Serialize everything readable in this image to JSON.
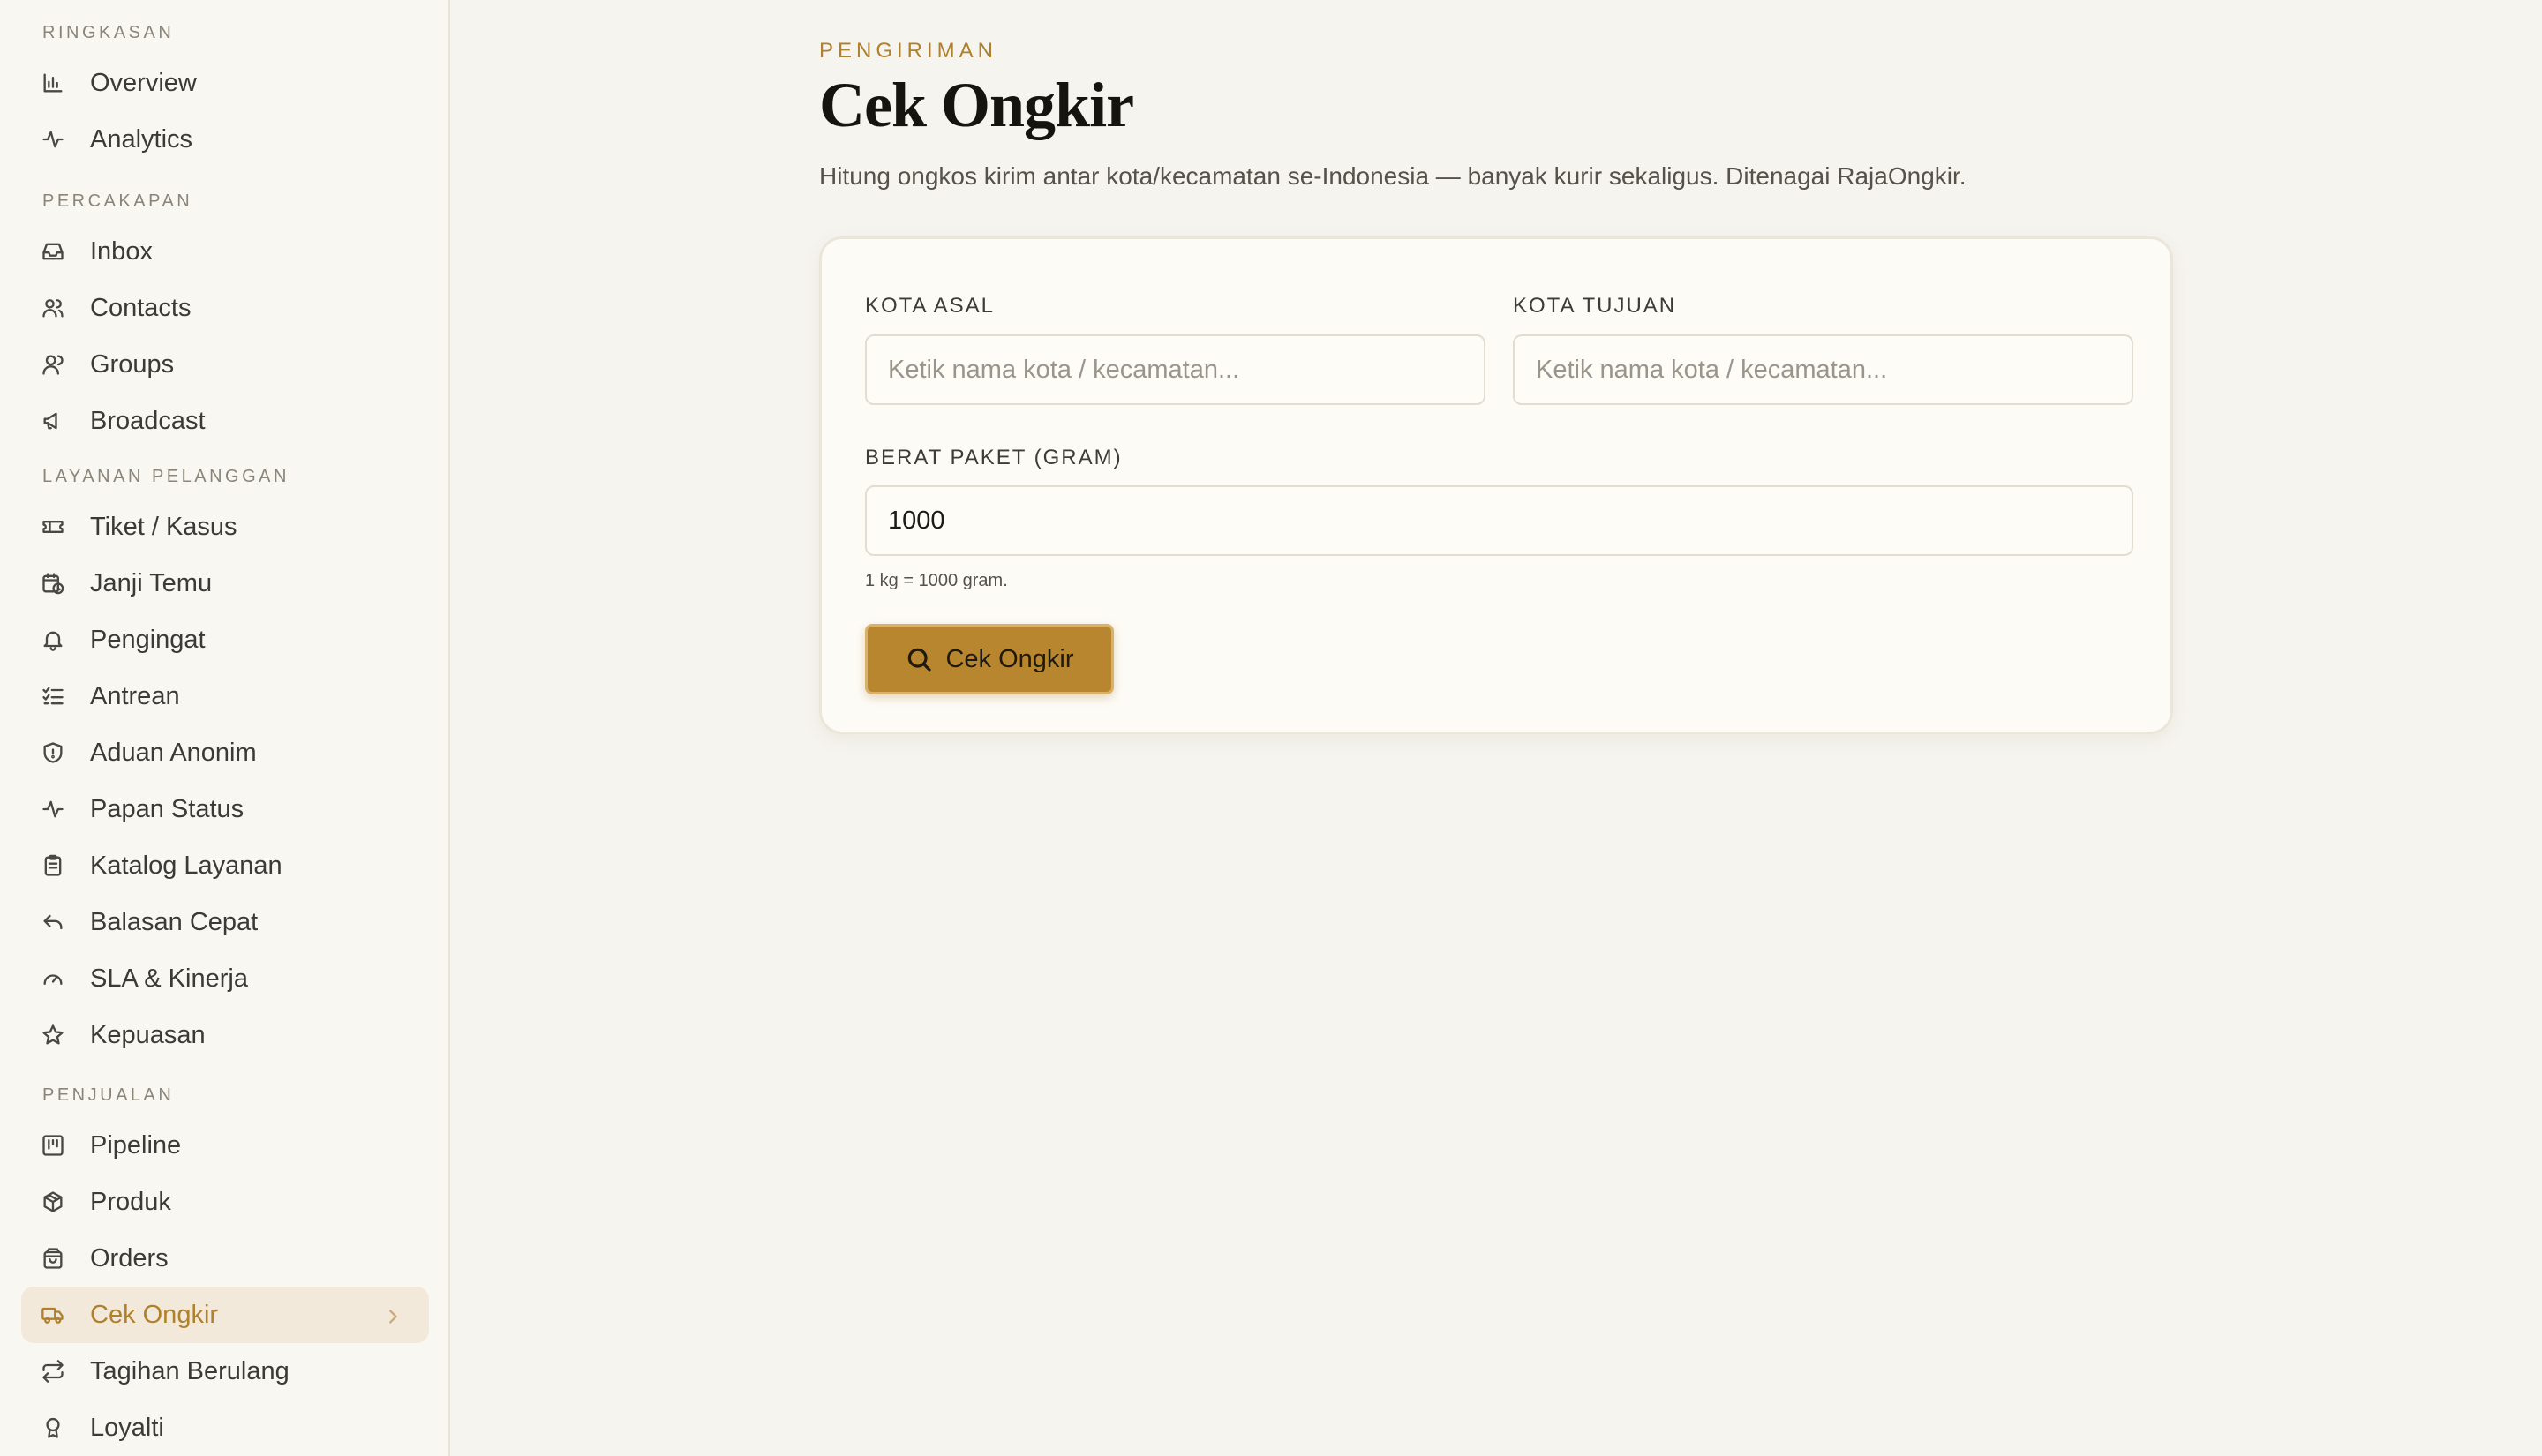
{
  "sidebar": {
    "sections": [
      {
        "title": "RINGKASAN",
        "items": [
          {
            "label": "Overview",
            "icon": "bar-chart-icon"
          },
          {
            "label": "Analytics",
            "icon": "activity-icon"
          }
        ]
      },
      {
        "title": "PERCAKAPAN",
        "items": [
          {
            "label": "Inbox",
            "icon": "inbox-icon"
          },
          {
            "label": "Contacts",
            "icon": "users-icon"
          },
          {
            "label": "Groups",
            "icon": "group-icon"
          },
          {
            "label": "Broadcast",
            "icon": "megaphone-icon"
          }
        ]
      },
      {
        "title": "LAYANAN PELANGGAN",
        "items": [
          {
            "label": "Tiket / Kasus",
            "icon": "ticket-icon"
          },
          {
            "label": "Janji Temu",
            "icon": "calendar-clock-icon"
          },
          {
            "label": "Pengingat",
            "icon": "bell-icon"
          },
          {
            "label": "Antrean",
            "icon": "list-checks-icon"
          },
          {
            "label": "Aduan Anonim",
            "icon": "shield-icon"
          },
          {
            "label": "Papan Status",
            "icon": "pulse-icon"
          },
          {
            "label": "Katalog Layanan",
            "icon": "clipboard-icon"
          },
          {
            "label": "Balasan Cepat",
            "icon": "reply-icon"
          },
          {
            "label": "SLA & Kinerja",
            "icon": "gauge-icon"
          },
          {
            "label": "Kepuasan",
            "icon": "star-icon"
          }
        ]
      },
      {
        "title": "PENJUALAN",
        "items": [
          {
            "label": "Pipeline",
            "icon": "kanban-icon"
          },
          {
            "label": "Produk",
            "icon": "box-icon"
          },
          {
            "label": "Orders",
            "icon": "shopping-bag-icon"
          },
          {
            "label": "Cek Ongkir",
            "icon": "truck-icon",
            "active": true
          },
          {
            "label": "Tagihan Berulang",
            "icon": "repeat-icon"
          },
          {
            "label": "Loyalti",
            "icon": "award-icon"
          }
        ]
      }
    ]
  },
  "header": {
    "eyebrow": "PENGIRIMAN",
    "title": "Cek Ongkir",
    "subtitle": "Hitung ongkos kirim antar kota/kecamatan se-Indonesia — banyak kurir sekaligus. Ditenagai RajaOngkir."
  },
  "form": {
    "origin_label": "KOTA ASAL",
    "origin_placeholder": "Ketik nama kota / kecamatan...",
    "origin_value": "",
    "destination_label": "KOTA TUJUAN",
    "destination_placeholder": "Ketik nama kota / kecamatan...",
    "destination_value": "",
    "weight_label": "BERAT PAKET (GRAM)",
    "weight_value": "1000",
    "weight_hint": "1 kg = 1000 gram.",
    "submit_label": "Cek Ongkir",
    "submit_icon": "search-icon"
  },
  "colors": {
    "accent": "#b8862e",
    "accent_text": "#b0812d",
    "active_bg": "#f3e9da",
    "page_bg": "#f6f4ef"
  }
}
